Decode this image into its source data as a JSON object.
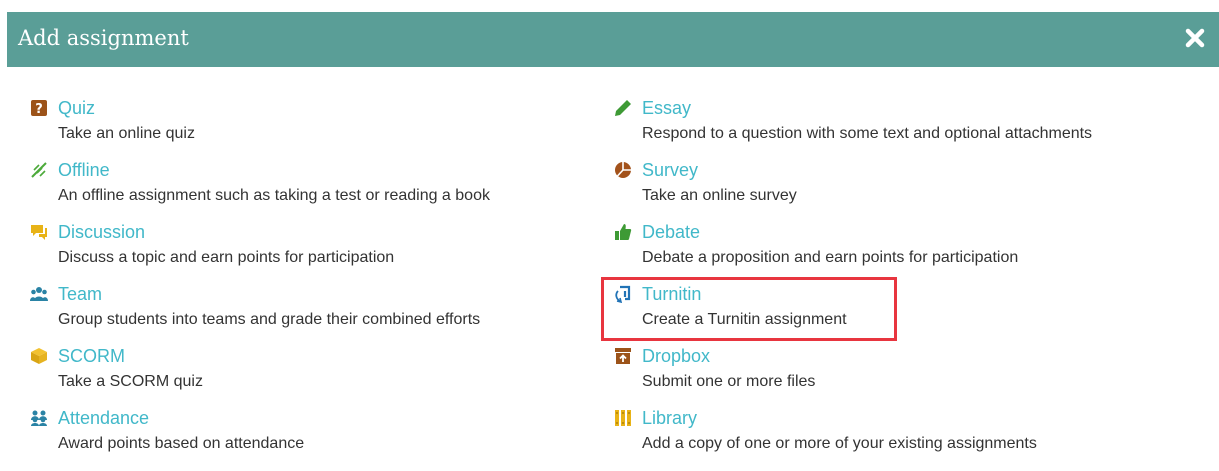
{
  "dialog": {
    "title": "Add assignment",
    "close_icon": "close-icon"
  },
  "colors": {
    "header": "#5a9e97",
    "link": "#41b8c9",
    "text": "#333333",
    "highlight": "#e8353f"
  },
  "left": [
    {
      "name": "Quiz",
      "desc": "Take an online quiz",
      "icon": "quiz-icon"
    },
    {
      "name": "Offline",
      "desc": "An offline assignment such as taking a test or reading a book",
      "icon": "offline-icon"
    },
    {
      "name": "Discussion",
      "desc": "Discuss a topic and earn points for participation",
      "icon": "discussion-icon"
    },
    {
      "name": "Team",
      "desc": "Group students into teams and grade their combined efforts",
      "icon": "team-icon"
    },
    {
      "name": "SCORM",
      "desc": "Take a SCORM quiz",
      "icon": "scorm-icon"
    },
    {
      "name": "Attendance",
      "desc": "Award points based on attendance",
      "icon": "attendance-icon"
    }
  ],
  "right": [
    {
      "name": "Essay",
      "desc": "Respond to a question with some text and optional attachments",
      "icon": "essay-icon"
    },
    {
      "name": "Survey",
      "desc": "Take an online survey",
      "icon": "survey-icon"
    },
    {
      "name": "Debate",
      "desc": "Debate a proposition and earn points for participation",
      "icon": "debate-icon"
    },
    {
      "name": "Turnitin",
      "desc": "Create a Turnitin assignment",
      "icon": "turnitin-icon"
    },
    {
      "name": "Dropbox",
      "desc": "Submit one or more files",
      "icon": "dropbox-icon"
    },
    {
      "name": "Library",
      "desc": "Add a copy of one or more of your existing assignments",
      "icon": "library-icon"
    }
  ]
}
